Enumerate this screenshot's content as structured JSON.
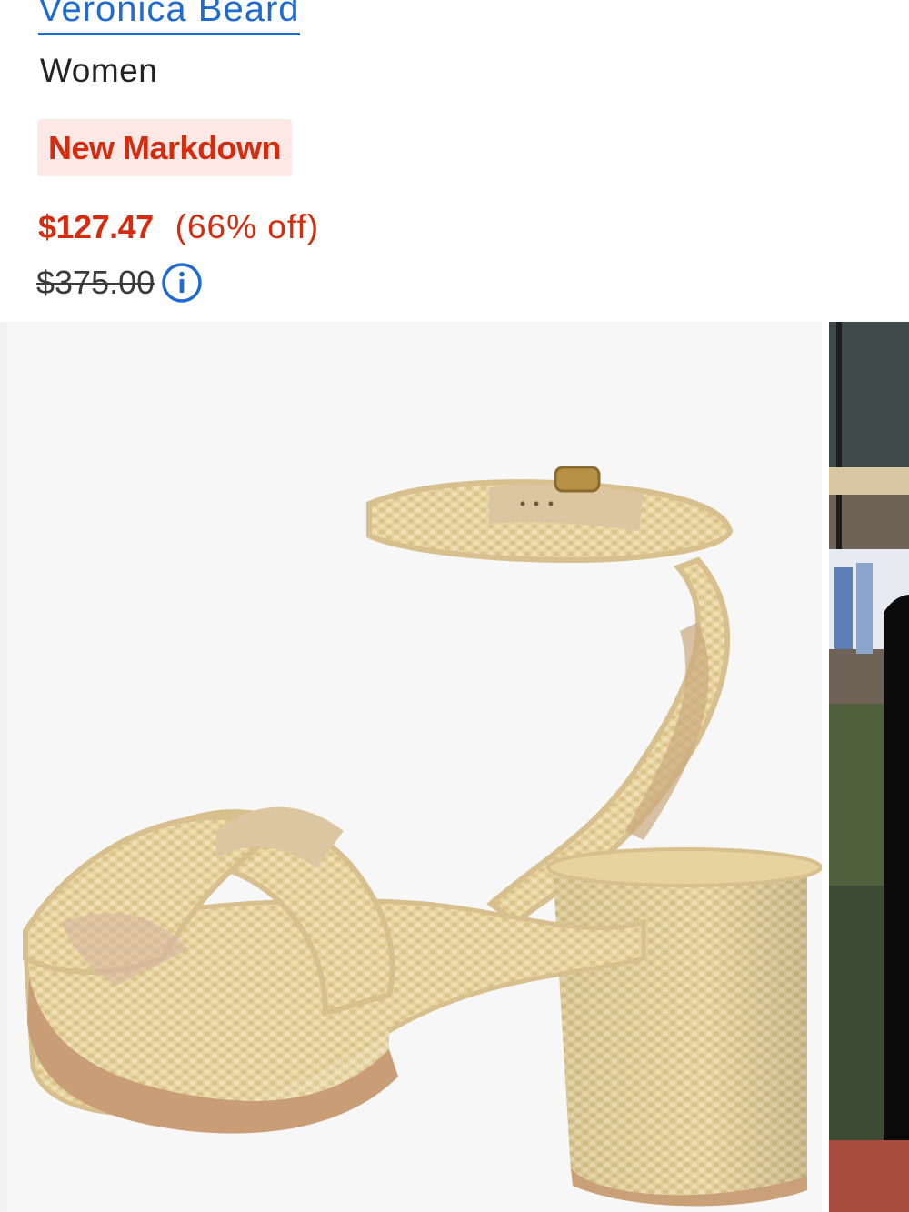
{
  "product": {
    "brand": "Veronica Beard",
    "category": "Women",
    "badge": "New Markdown",
    "sale_price": "$127.47",
    "discount": "(66% off)",
    "original_price": "$375.00"
  },
  "colors": {
    "link": "#1f6bd1",
    "sale": "#d52b0e",
    "badge_bg": "#fce8e4",
    "image_bg": "#f7f7f7"
  },
  "icons": {
    "info": "info-circle-icon"
  },
  "gallery": {
    "main_image": "woven-block-heel-sandal",
    "next_image": "store-rack-model"
  }
}
